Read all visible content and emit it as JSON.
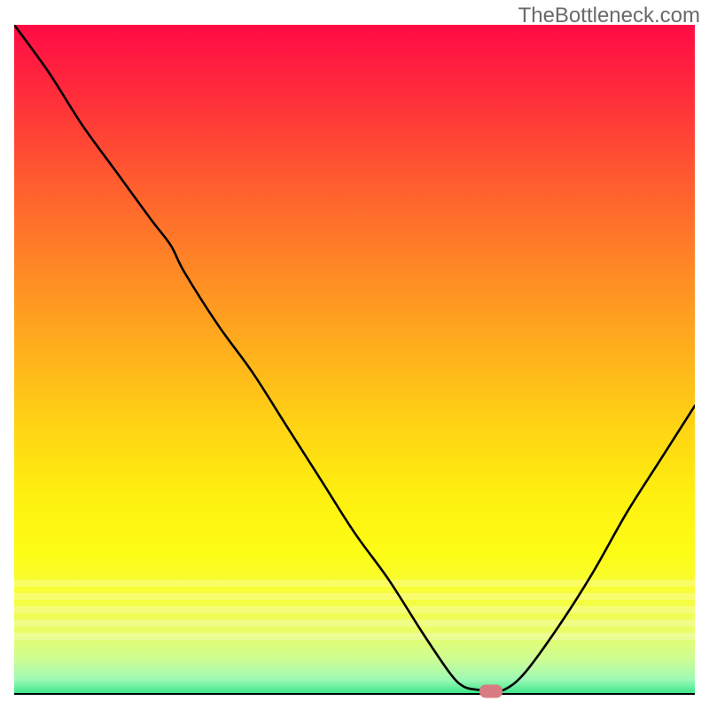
{
  "watermark": "TheBottleneck.com",
  "chart_data": {
    "type": "line",
    "title": "",
    "xlabel": "",
    "ylabel": "",
    "xlim": [
      0,
      100
    ],
    "ylim": [
      0,
      100
    ],
    "x": [
      0,
      5,
      10,
      15,
      20,
      23,
      25,
      30,
      35,
      40,
      45,
      50,
      55,
      60,
      64,
      66,
      68,
      70,
      72,
      75,
      80,
      85,
      90,
      95,
      100
    ],
    "values": [
      100,
      93,
      85,
      78,
      71,
      67,
      63,
      55,
      48,
      40,
      32,
      24,
      17,
      9,
      3,
      1,
      0.5,
      0.5,
      0.5,
      3,
      10,
      18,
      27,
      35,
      43
    ],
    "minimum_point": {
      "x": 70,
      "y": 0.5
    },
    "gradient_top_color": "#ff0b45",
    "gradient_bottom_color": "#3ee789",
    "marker_color": "#d97b82"
  }
}
